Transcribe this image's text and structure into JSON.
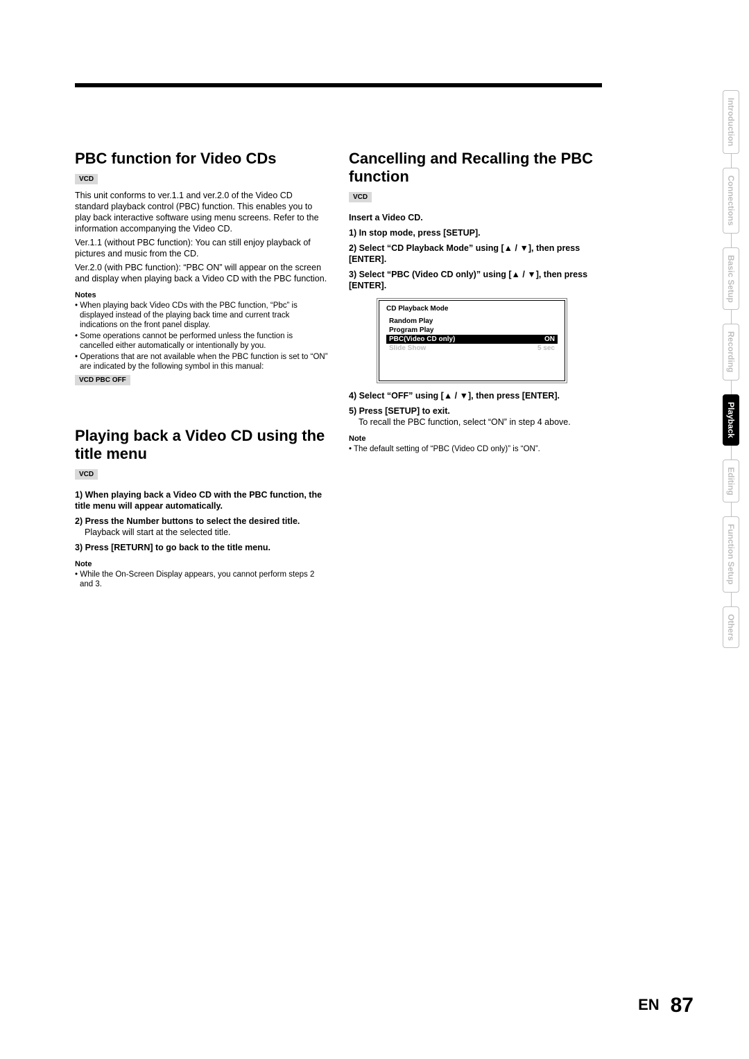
{
  "page": {
    "lang": "EN",
    "number": "87"
  },
  "tabs": [
    "Introduction",
    "Connections",
    "Basic Setup",
    "Recording",
    "Playback",
    "Editing",
    "Function Setup",
    "Others"
  ],
  "tabs_active_index": 4,
  "badges": {
    "vcd": "VCD",
    "vcd_pbc_off": "VCD PBC OFF"
  },
  "left": {
    "h1": "PBC function for Video CDs",
    "p1": "This unit conforms to ver.1.1 and ver.2.0 of the Video CD standard playback control (PBC) function. This enables you to play back interactive software using menu screens. Refer to the information accompanying the Video CD.",
    "p2": "Ver.1.1 (without PBC function): You can still enjoy playback of pictures and music from the CD.",
    "p3": "Ver.2.0 (with PBC function): “PBC ON” will appear on the screen and display when playing back a Video CD with the PBC function.",
    "notes_head": "Notes",
    "n1": "• When playing back Video CDs with the PBC function, “Pbc” is displayed instead of the playing back time and current track indications on the front panel display.",
    "n2": "• Some operations cannot be performed unless the function is cancelled either automatically or intentionally by you.",
    "n3": "• Operations that are not available when the PBC function is set to “ON” are indicated by the following symbol in this manual:",
    "h2": "Playing back a Video CD using the title menu",
    "s1": "1) When playing back a Video CD with the PBC function, the title menu will appear automatically.",
    "s2": "2) Press the Number buttons to select the desired title.",
    "s2b": "Playback will start at the selected title.",
    "s3": "3) Press [RETURN] to go back to the title menu.",
    "note_head2": "Note",
    "note2": "• While the On-Screen Display appears, you cannot perform steps 2 and 3."
  },
  "right": {
    "h1": "Cancelling and Recalling the PBC function",
    "s0": "Insert a Video CD.",
    "s1": "1) In stop mode, press [SETUP].",
    "s2a": "2) Select “CD Playback Mode” using [",
    "s2b": "], then press [ENTER].",
    "s3a": "3) Select “PBC (Video CD only)” using [",
    "s3b": "], then press [ENTER].",
    "s4a": "4) Select “OFF” using [",
    "s4b": "], then press [ENTER].",
    "s5": "5) Press [SETUP] to exit.",
    "s5b": "To recall the PBC function, select “ON” in step 4 above.",
    "note_head": "Note",
    "note": "• The default setting of “PBC (Video CD only)” is “ON”."
  },
  "osd": {
    "title": "CD Playback Mode",
    "rows": [
      {
        "label": "Random Play",
        "value": ""
      },
      {
        "label": "Program Play",
        "value": ""
      },
      {
        "label": "PBC(Video CD only)",
        "value": "ON"
      },
      {
        "label": "Slide Show",
        "value": "5 sec"
      }
    ]
  },
  "glyphs": {
    "up": "▲",
    "down": "▼",
    "sep": " / "
  }
}
